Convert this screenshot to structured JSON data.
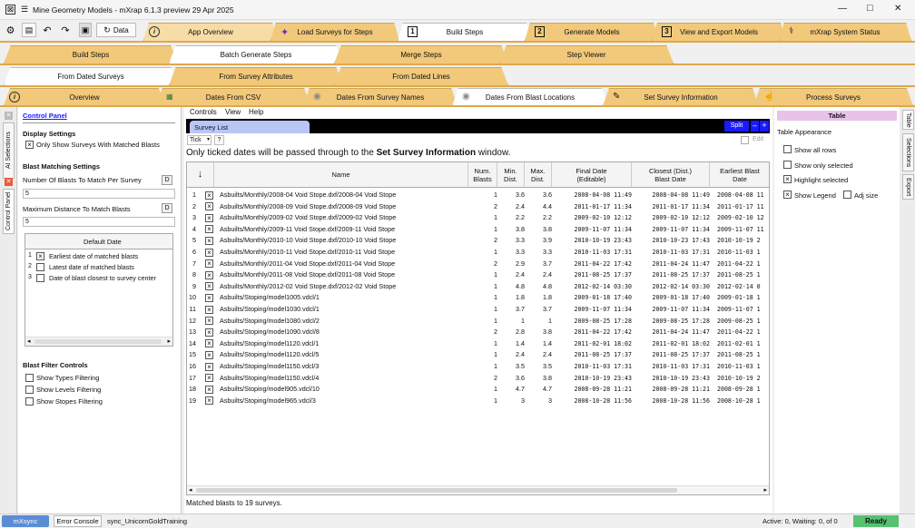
{
  "window": {
    "title": "Mine Geometry Models - mXrap 6.1.3 preview 29 Apr 2025",
    "controls": [
      "—",
      "□",
      "✕"
    ]
  },
  "toolbar": {
    "data_label": "Data"
  },
  "main_tabs": [
    "App Overview",
    "Load Surveys for Steps",
    "Build Steps",
    "Generate Models",
    "View and Export Models",
    "mXrap System Status"
  ],
  "main_tab_numbers": [
    "1",
    "2",
    "3"
  ],
  "sub_tabs": [
    "Build Steps",
    "Batch Generate Steps",
    "Merge Steps",
    "Step Viewer"
  ],
  "sub_tabs2": [
    "From Dated Surveys",
    "From Survey Attributes",
    "From Dated Lines"
  ],
  "sub_tabs3": [
    "Overview",
    "Dates From CSV",
    "Dates From Survey Names",
    "Dates From Blast Locations",
    "Set Survey Information",
    "Process Surveys"
  ],
  "left_strip": {
    "ai": "AI Selections",
    "cp": "Control Panel"
  },
  "control_panel": {
    "title": "Control Panel",
    "display_settings": "Display Settings",
    "only_matched": "Only Show Surveys With Matched Blasts",
    "blast_matching": "Blast Matching Settings",
    "num_blasts_label": "Number Of Blasts To Match Per Survey",
    "num_blasts_value": "5",
    "max_dist_label": "Maximum Distance To Match Blasts",
    "max_dist_value": "5",
    "d_btn": "D",
    "default_date_header": "Default Date",
    "default_date_rows": [
      "Earliest date of matched blasts",
      "Latest date of matched blasts",
      "Date of blast closest to survey center"
    ],
    "blast_filter": "Blast Filter Controls",
    "filter_types": "Show Types Filtering",
    "filter_levels": "Show Levels Filtering",
    "filter_stopes": "Show Stopes Filtering"
  },
  "menu": [
    "Controls",
    "View",
    "Help"
  ],
  "survey_list": {
    "tab": "Survey List",
    "split": "Split",
    "tick_label": "Tick",
    "help": "?",
    "edit": "Edit",
    "note_prefix": "Only ticked dates will be passed through to the ",
    "note_bold": "Set Survey Information",
    "note_suffix": " window.",
    "columns": [
      "",
      "Name",
      "Num. Blasts",
      "Min. Dist.",
      "Max. Dist.",
      "Final Date (Editable)",
      "Closest (Dist.) Blast Date",
      "Earliest Blast Date"
    ],
    "rows": [
      [
        "1",
        "Asbuilts/Monthly/2008-04 Void Stope.dxf/2008-04 Void Stope",
        "1",
        "3.6",
        "3.6",
        "2008-04-08 11:49",
        "2008-04-08 11:49",
        "2008-04-08 11"
      ],
      [
        "2",
        "Asbuilts/Monthly/2008-09 Void Stope.dxf/2008-09 Void Stope",
        "2",
        "2.4",
        "4.4",
        "2011-01-17 11:34",
        "2011-01-17 11:34",
        "2011-01-17 11"
      ],
      [
        "3",
        "Asbuilts/Monthly/2009-02 Void Stope.dxf/2009-02 Void Stope",
        "1",
        "2.2",
        "2.2",
        "2009-02-10 12:12",
        "2009-02-10 12:12",
        "2009-02-10 12"
      ],
      [
        "4",
        "Asbuilts/Monthly/2009-11 Void Stope.dxf/2009-11 Void Stope",
        "1",
        "3.8",
        "3.8",
        "2009-11-07 11:34",
        "2009-11-07 11:34",
        "2009-11-07 11"
      ],
      [
        "5",
        "Asbuilts/Monthly/2010-10 Void Stope.dxf/2010-10 Void Stope",
        "2",
        "3.3",
        "3.9",
        "2010-10-19 23:43",
        "2010-10-23 17:43",
        "2010-10-19 2"
      ],
      [
        "6",
        "Asbuilts/Monthly/2010-11 Void Stope.dxf/2010-11 Void Stope",
        "1",
        "3.3",
        "3.3",
        "2010-11-03 17:31",
        "2010-11-03 17:31",
        "2010-11-03 1"
      ],
      [
        "7",
        "Asbuilts/Monthly/2011-04 Void Stope.dxf/2011-04 Void Stope",
        "2",
        "2.9",
        "3.7",
        "2011-04-22 17:42",
        "2011-04-24 11:47",
        "2011-04-22 1"
      ],
      [
        "8",
        "Asbuilts/Monthly/2011-08 Void Stope.dxf/2011-08 Void Stope",
        "1",
        "2.4",
        "2.4",
        "2011-08-25 17:37",
        "2011-08-25 17:37",
        "2011-08-25 1"
      ],
      [
        "9",
        "Asbuilts/Monthly/2012-02 Void Stope.dxf/2012-02 Void Stope",
        "1",
        "4.8",
        "4.8",
        "2012-02-14 03:30",
        "2012-02-14 03:30",
        "2012-02-14 0"
      ],
      [
        "10",
        "Asbuilts/Stoping/model1005.vdcl/1",
        "1",
        "1.8",
        "1.8",
        "2009-01-18 17:40",
        "2009-01-18 17:40",
        "2009-01-18 1"
      ],
      [
        "11",
        "Asbuilts/Stoping/model1030.vdcl/1",
        "1",
        "3.7",
        "3.7",
        "2009-11-07 11:34",
        "2009-11-07 11:34",
        "2009-11-07 1"
      ],
      [
        "12",
        "Asbuilts/Stoping/model1080.vdcl/2",
        "1",
        "1",
        "1",
        "2009-08-25 17:28",
        "2009-08-25 17:28",
        "2009-08-25 1"
      ],
      [
        "13",
        "Asbuilts/Stoping/model1090.vdcl/8",
        "2",
        "2.8",
        "3.8",
        "2011-04-22 17:42",
        "2011-04-24 11:47",
        "2011-04-22 1"
      ],
      [
        "14",
        "Asbuilts/Stoping/model1120.vdcl/1",
        "1",
        "1.4",
        "1.4",
        "2011-02-01 18:02",
        "2011-02-01 18:02",
        "2011-02-01 1"
      ],
      [
        "15",
        "Asbuilts/Stoping/model1120.vdcl/5",
        "1",
        "2.4",
        "2.4",
        "2011-08-25 17:37",
        "2011-08-25 17:37",
        "2011-08-25 1"
      ],
      [
        "16",
        "Asbuilts/Stoping/model1150.vdcl/3",
        "1",
        "3.5",
        "3.5",
        "2010-11-03 17:31",
        "2010-11-03 17:31",
        "2010-11-03 1"
      ],
      [
        "17",
        "Asbuilts/Stoping/model1150.vdcl/4",
        "2",
        "3.6",
        "3.8",
        "2010-10-19 23:43",
        "2010-10-19 23:43",
        "2010-10-19 2"
      ],
      [
        "18",
        "Asbuilts/Stoping/model905.vdcl/10",
        "1",
        "4.7",
        "4.7",
        "2008-09-28 11:21",
        "2008-09-28 11:21",
        "2008-09-28 1"
      ],
      [
        "19",
        "Asbuilts/Stoping/model965.vdcl/3",
        "1",
        "3",
        "3",
        "2008-10-28 11:56",
        "2008-10-28 11:56",
        "2008-10-28 1"
      ]
    ],
    "footer": "Matched blasts to 19 surveys."
  },
  "table_panel": {
    "title": "Table",
    "appearance": "Table Appearance",
    "show_all": "Show all rows",
    "show_selected": "Show only selected",
    "highlight": "Highlight selected",
    "legend": "Show Legend",
    "adj": "Adj size"
  },
  "right_strip": [
    "Table",
    "Selections",
    "Export"
  ],
  "status": {
    "mxsync": "mXsync",
    "error_console": "Error Console",
    "sync": "sync_UnicornGoldTraining",
    "active": "Active: 0, Waiting: 0, of  0",
    "ready": "Ready"
  },
  "colors": {
    "tab": "#f2c97b",
    "band": "#e0a84a",
    "accent": "#1a1aff",
    "ready": "#56c271",
    "mxsync": "#5b8dd6"
  }
}
